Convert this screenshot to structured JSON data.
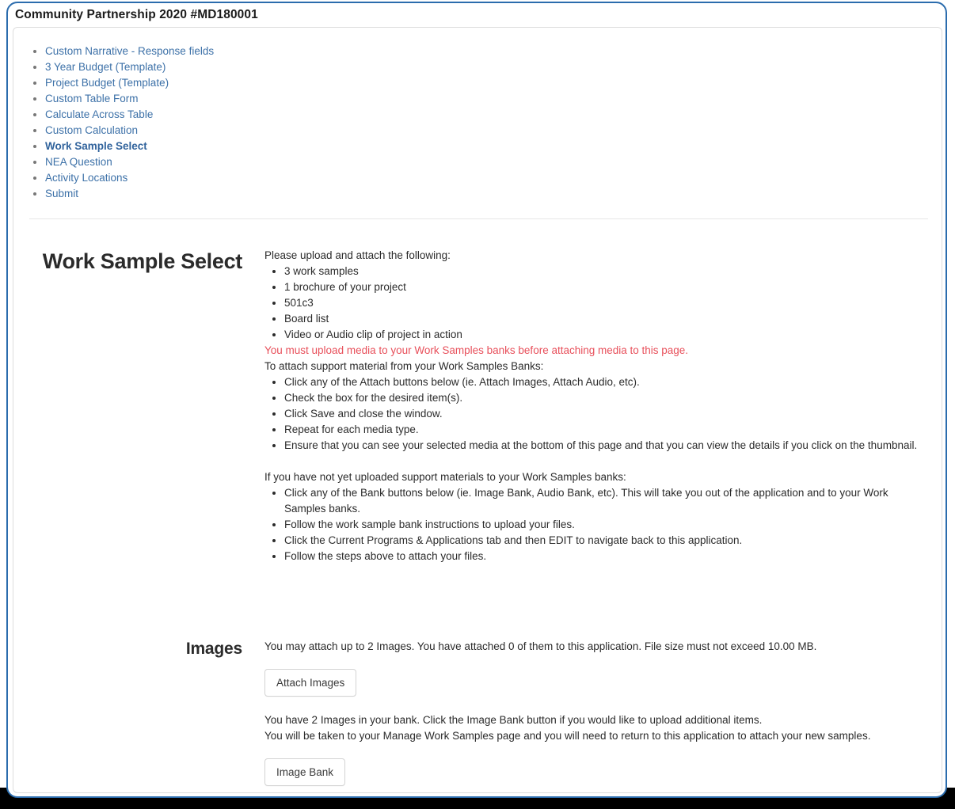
{
  "window": {
    "title": "Community Partnership 2020 #MD180001"
  },
  "nav": {
    "items": [
      {
        "label": "Custom Narrative - Response fields",
        "current": false
      },
      {
        "label": "3 Year Budget (Template)",
        "current": false
      },
      {
        "label": "Project Budget (Template)",
        "current": false
      },
      {
        "label": "Custom Table Form",
        "current": false
      },
      {
        "label": "Calculate Across Table",
        "current": false
      },
      {
        "label": "Custom Calculation",
        "current": false
      },
      {
        "label": "Work Sample Select",
        "current": true
      },
      {
        "label": "NEA Question",
        "current": false
      },
      {
        "label": "Activity Locations",
        "current": false
      },
      {
        "label": "Submit",
        "current": false
      }
    ]
  },
  "work_sample_select": {
    "label": "Work Sample Select",
    "upload_intro": "Please upload and attach the following:",
    "upload_items": [
      "3 work samples",
      "1 brochure of your project",
      "501c3",
      "Board list",
      "Video or Audio clip of project in action"
    ],
    "warning": "You must upload media to your Work Samples banks before attaching media to this page.",
    "attach_intro": "To attach support material from your Work Samples Banks:",
    "attach_steps": [
      "Click any of the Attach buttons below (ie. Attach Images, Attach Audio, etc).",
      "Check the box for the desired item(s).",
      "Click Save and close the window.",
      "Repeat for each media type.",
      "Ensure that you can see your selected media at the bottom of this page and that you can view the details if you click on the thumbnail."
    ],
    "bank_intro": "If you have not yet uploaded support materials to your Work Samples banks:",
    "bank_steps": [
      "Click any of the Bank buttons below (ie. Image Bank, Audio Bank, etc). This will take you out of the application and to your Work Samples banks.",
      "Follow the work sample bank instructions to upload your files.",
      "Click the Current Programs & Applications tab and then EDIT to navigate back to this application.",
      "Follow the steps above to attach your files."
    ]
  },
  "images": {
    "label": "Images",
    "attach_status": "You may attach up to 2 Images. You have attached 0 of them to this application. File size must not exceed 10.00 MB.",
    "attach_button": "Attach Images",
    "bank_status_line1": "You have 2 Images in your bank. Click the Image Bank button if you would like to upload additional items.",
    "bank_status_line2": "You will be taken to your Manage Work Samples page and you will need to return to this application to attach your new samples.",
    "bank_button": "Image Bank"
  },
  "colors": {
    "frame_blue": "#2b6cad",
    "link_blue": "#3d71a8",
    "warning_red": "#e8505b",
    "panel_border": "#dddddd"
  }
}
